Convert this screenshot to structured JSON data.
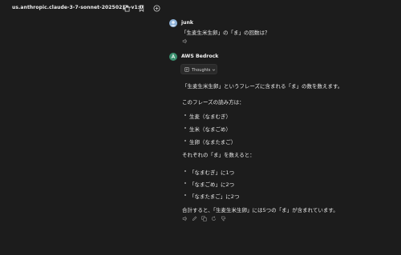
{
  "header": {
    "model_id": "us.anthropic.claude-3-7-sonnet-20250219-v1:0",
    "icons": [
      "copy-icon",
      "bookmark-icon",
      "add-icon"
    ]
  },
  "user_message": {
    "sender": "junk",
    "text": "「生麦生米生卵」の「ま」の回数は？",
    "icons": [
      "speaker-icon"
    ]
  },
  "assistant_message": {
    "sender": "AWS Bedrock",
    "thoughts_label": "Thoughts",
    "paragraphs": [
      "「生麦生米生卵」というフレーズに含まれる「ま」の数を数えます。",
      "このフレーズの読み方は：",
      "それぞれの「ま」を数えると：",
      "合計すると、「生麦生米生卵」には5つの「ま」が含まれています。"
    ],
    "readings": [
      "生麦（なまむぎ）",
      "生米（なまごめ）",
      "生卵（なまたまご）"
    ],
    "counts": [
      "「なまむぎ」に1つ",
      "「なまごめ」に2つ",
      "「なまたまご」に2つ"
    ],
    "action_icons": [
      "speaker-icon",
      "edit-icon",
      "copy-icon",
      "retry-icon",
      "thumbs-down-icon"
    ]
  },
  "colors": {
    "background": "#1c1c1c",
    "text": "#e8e8e8",
    "user_avatar": "#8fb3d9",
    "assistant_avatar": "#3a8f6e"
  }
}
